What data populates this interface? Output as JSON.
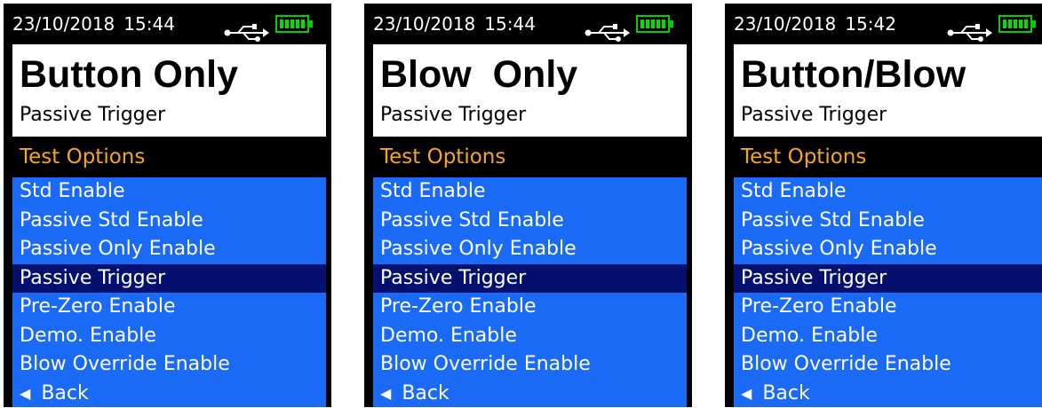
{
  "colors": {
    "frame": "#000000",
    "title_panel": "#ffffff",
    "section_header_text": "#f5a623",
    "menu_bg": "#1a6af5",
    "menu_selected_bg": "#06106e",
    "battery": "#00d000"
  },
  "screens": [
    {
      "date": "23/10/2018",
      "time": "15:44",
      "usb_icon": "usb-icon",
      "battery_icon": "battery-full-icon",
      "title": "Button Only",
      "subtitle": "Passive Trigger",
      "section_header": "Test Options",
      "menu_items": [
        {
          "label": "Std Enable"
        },
        {
          "label": "Passive Std Enable"
        },
        {
          "label": "Passive Only Enable"
        },
        {
          "label": "Passive Trigger",
          "selected": true
        },
        {
          "label": "Pre-Zero Enable"
        },
        {
          "label": "Demo. Enable"
        },
        {
          "label": "Blow Override Enable"
        }
      ],
      "back_icon": "back-arrow-icon",
      "back_label": "Back"
    },
    {
      "date": "23/10/2018",
      "time": "15:44",
      "usb_icon": "usb-icon",
      "battery_icon": "battery-full-icon",
      "title": "Blow  Only",
      "subtitle": "Passive Trigger",
      "section_header": "Test Options",
      "menu_items": [
        {
          "label": "Std Enable"
        },
        {
          "label": "Passive Std Enable"
        },
        {
          "label": "Passive Only Enable"
        },
        {
          "label": "Passive Trigger",
          "selected": true
        },
        {
          "label": "Pre-Zero Enable"
        },
        {
          "label": "Demo. Enable"
        },
        {
          "label": "Blow Override Enable"
        }
      ],
      "back_icon": "back-arrow-icon",
      "back_label": "Back"
    },
    {
      "date": "23/10/2018",
      "time": "15:42",
      "usb_icon": "usb-icon",
      "battery_icon": "battery-full-icon",
      "title": "Button/Blow",
      "subtitle": "Passive Trigger",
      "section_header": "Test Options",
      "menu_items": [
        {
          "label": "Std Enable"
        },
        {
          "label": "Passive Std Enable"
        },
        {
          "label": "Passive Only Enable"
        },
        {
          "label": "Passive Trigger",
          "selected": true
        },
        {
          "label": "Pre-Zero Enable"
        },
        {
          "label": "Demo. Enable"
        },
        {
          "label": "Blow Override Enable"
        }
      ],
      "back_icon": "back-arrow-icon",
      "back_label": "Back"
    }
  ]
}
